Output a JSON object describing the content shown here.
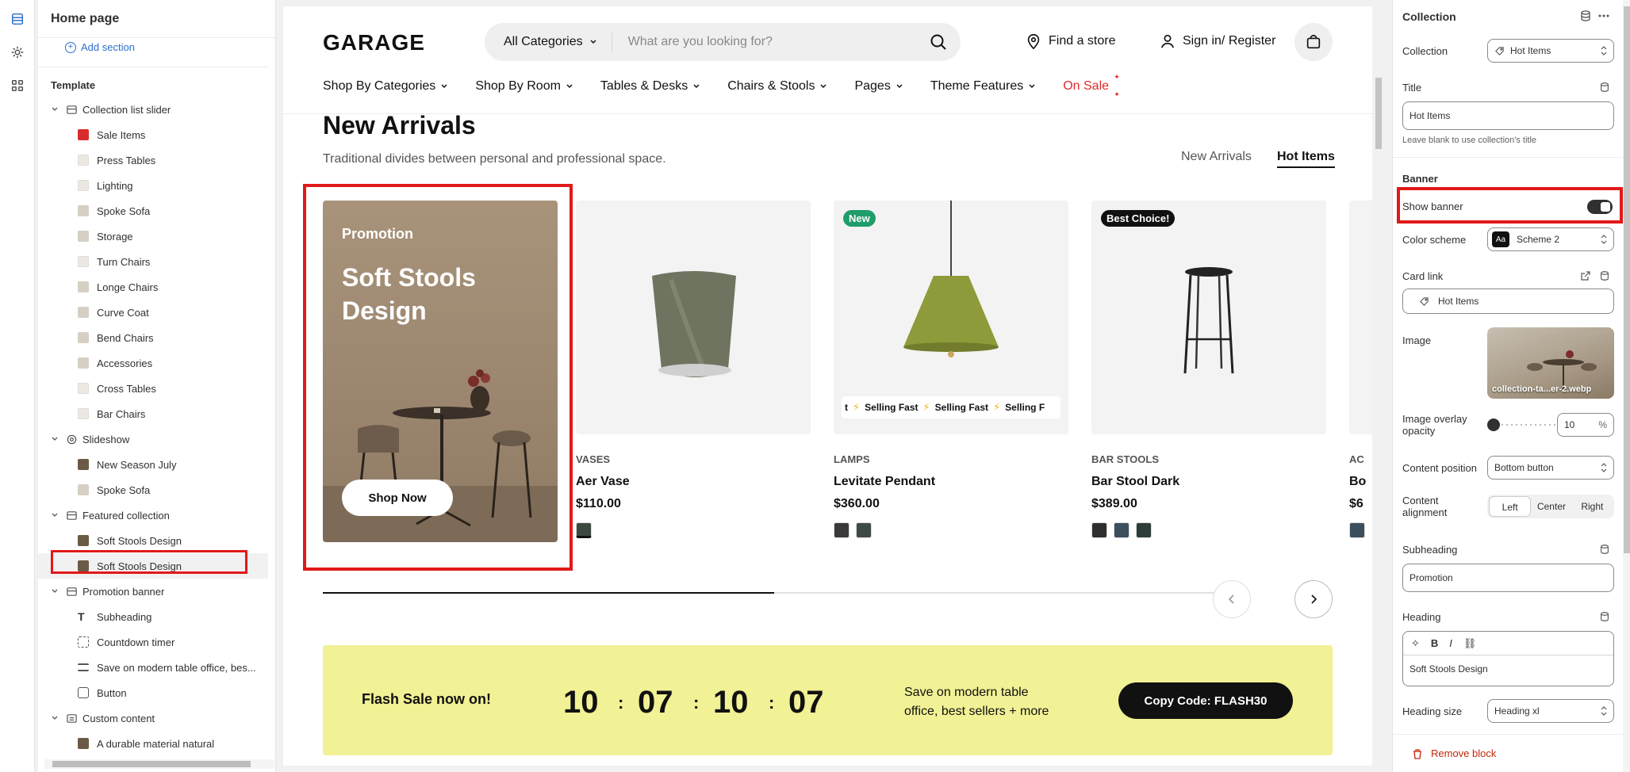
{
  "left": {
    "title": "Home page",
    "add_section": "Add section",
    "template_label": "Template",
    "groups": [
      {
        "label": "Collection list slider",
        "items": [
          "Sale Items",
          "Press Tables",
          "Lighting",
          "Spoke Sofa",
          "Storage",
          "Turn Chairs",
          "Longe Chairs",
          "Curve Coat",
          "Bend Chairs",
          "Accessories",
          "Cross Tables",
          "Bar Chairs"
        ]
      },
      {
        "label": "Slideshow",
        "items": [
          "New Season July",
          "Spoke Sofa"
        ]
      },
      {
        "label": "Featured collection",
        "items": [
          "Soft Stools Design",
          "Soft Stools Design"
        ]
      },
      {
        "label": "Promotion banner",
        "items": [
          "Subheading",
          "Countdown timer",
          "Save on modern table office, bes...",
          "Button"
        ]
      },
      {
        "label": "Custom content",
        "items": [
          "A durable material natural"
        ]
      }
    ]
  },
  "store": {
    "logo": "GARAGE",
    "search_category": "All Categories",
    "search_placeholder": "What are you looking for?",
    "find_store": "Find a store",
    "sign_in": "Sign in/ Register",
    "nav": [
      "Shop By Categories",
      "Shop By Room",
      "Tables & Desks",
      "Chairs & Stools",
      "Pages",
      "Theme Features"
    ],
    "nav_sale": "On Sale",
    "section_title": "New Arrivals",
    "section_sub": "Traditional divides between personal and professional space.",
    "tab_new": "New Arrivals",
    "tab_hot": "Hot Items",
    "banner": {
      "subheading": "Promotion",
      "heading": "Soft Stools Design",
      "button": "Shop Now"
    },
    "products": [
      {
        "category": "VASES",
        "name": "Aer Vase",
        "price": "$110.00",
        "badge": ""
      },
      {
        "category": "LAMPS",
        "name": "Levitate Pendant",
        "price": "$360.00",
        "badge": "New"
      },
      {
        "category": "BAR STOOLS",
        "name": "Bar Stool Dark",
        "price": "$389.00",
        "badge": "Best Choice!"
      },
      {
        "category": "AC",
        "name": "Bo",
        "price": "$6",
        "badge": ""
      }
    ],
    "marquee_text": "Selling Fast",
    "marquee_partial_left": "t",
    "marquee_partial_right": "Selling F",
    "slider_progress": 0.5,
    "flash": {
      "title": "Flash Sale now on!",
      "d": "10",
      "h": "07",
      "m": "10",
      "s": "07",
      "colon": ":",
      "subtitle": "Save on modern table office, best sellers + more",
      "button": "Copy Code: FLASH30"
    }
  },
  "right": {
    "title": "Collection",
    "collection_label": "Collection",
    "collection_value": "Hot Items",
    "title_label": "Title",
    "title_value": "Hot Items",
    "title_hint": "Leave blank to use collection's title",
    "banner_heading": "Banner",
    "show_banner": "Show banner",
    "show_banner_on": true,
    "color_scheme_label": "Color scheme",
    "color_scheme_value": "Scheme 2",
    "scheme_swatch": "Aa",
    "card_link_label": "Card link",
    "card_link_value": "Hot Items",
    "image_label": "Image",
    "image_file": "collection-ta...er-2.webp",
    "overlay_label": "Image overlay opacity",
    "overlay_value": "10",
    "overlay_unit": "%",
    "content_position_label": "Content position",
    "content_position_value": "Bottom button",
    "alignment_label": "Content alignment",
    "alignment_options": [
      "Left",
      "Center",
      "Right"
    ],
    "alignment_selected": "Left",
    "subheading_label": "Subheading",
    "subheading_value": "Promotion",
    "heading_label": "Heading",
    "heading_value": "Soft Stools Design",
    "heading_size_label": "Heading size",
    "heading_size_value": "Heading xl",
    "remove_block": "Remove block"
  },
  "colors": {
    "accent_red": "#e11919",
    "link_blue": "#2c6ecb",
    "flash_bg": "#f1f195",
    "sale_red": "#e12b2b",
    "badge_green": "#1f9d6b"
  }
}
